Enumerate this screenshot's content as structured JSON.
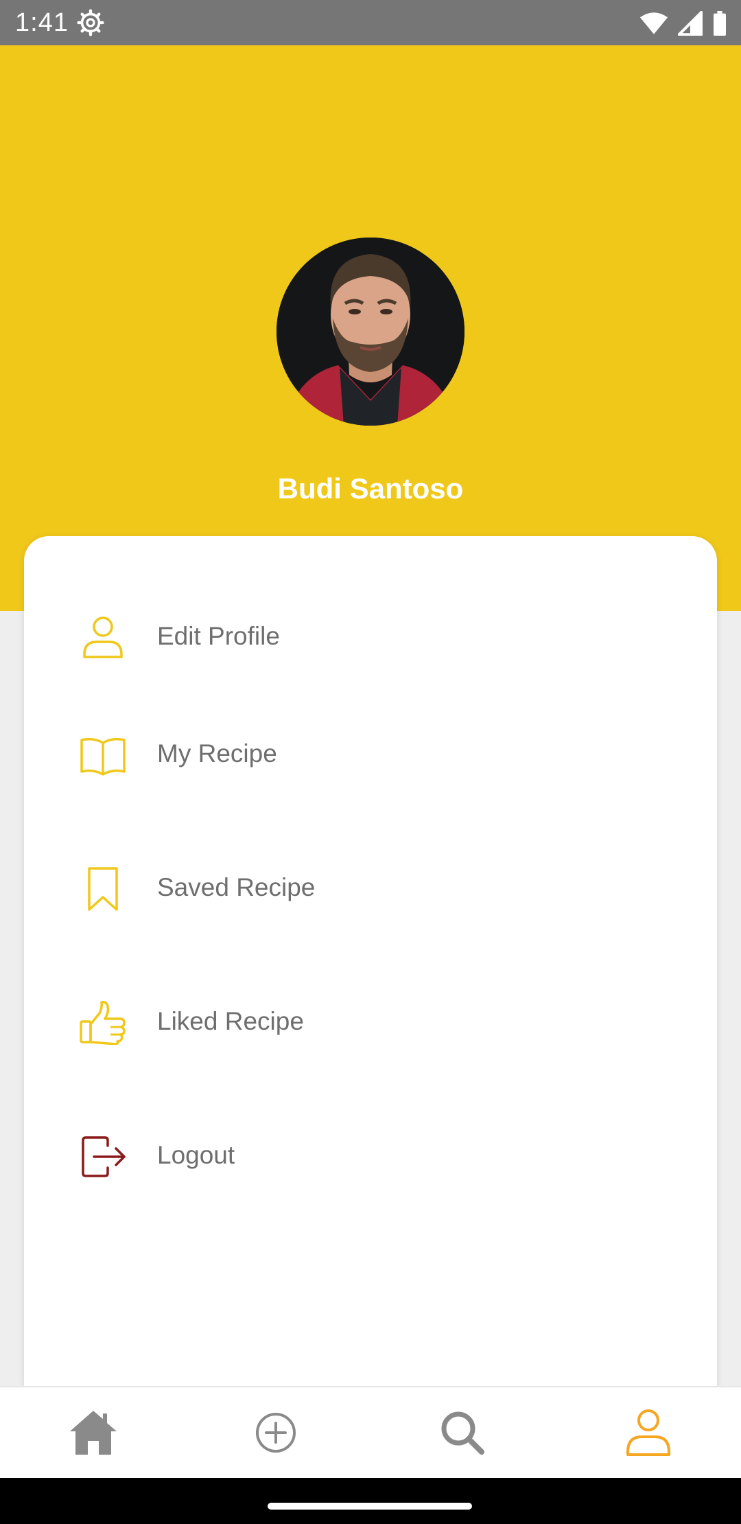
{
  "status_bar": {
    "time": "1:41",
    "icons": [
      "settings-gear-icon",
      "wifi-icon",
      "cell-signal-icon",
      "battery-icon"
    ]
  },
  "profile": {
    "name": "Budi Santoso",
    "avatar": "profile-photo"
  },
  "menu": {
    "items": [
      {
        "label": "Edit Profile",
        "icon": "user-icon"
      },
      {
        "label": "My Recipe",
        "icon": "open-book-icon"
      },
      {
        "label": "Saved Recipe",
        "icon": "bookmark-icon"
      },
      {
        "label": "Liked Recipe",
        "icon": "thumbs-up-icon"
      },
      {
        "label": "Logout",
        "icon": "logout-icon"
      }
    ]
  },
  "bottom_nav": {
    "items": [
      {
        "icon": "home-icon",
        "active": false
      },
      {
        "icon": "add-circle-icon",
        "active": false
      },
      {
        "icon": "search-icon",
        "active": false
      },
      {
        "icon": "profile-icon",
        "active": true
      }
    ]
  },
  "colors": {
    "header_yellow": "#F0C81A",
    "icon_yellow": "#F0C81A",
    "logout_red": "#8B1A1A",
    "active_orange": "#F5A623",
    "inactive_gray": "#8A8A8A",
    "label_gray": "#6E6E6E"
  }
}
